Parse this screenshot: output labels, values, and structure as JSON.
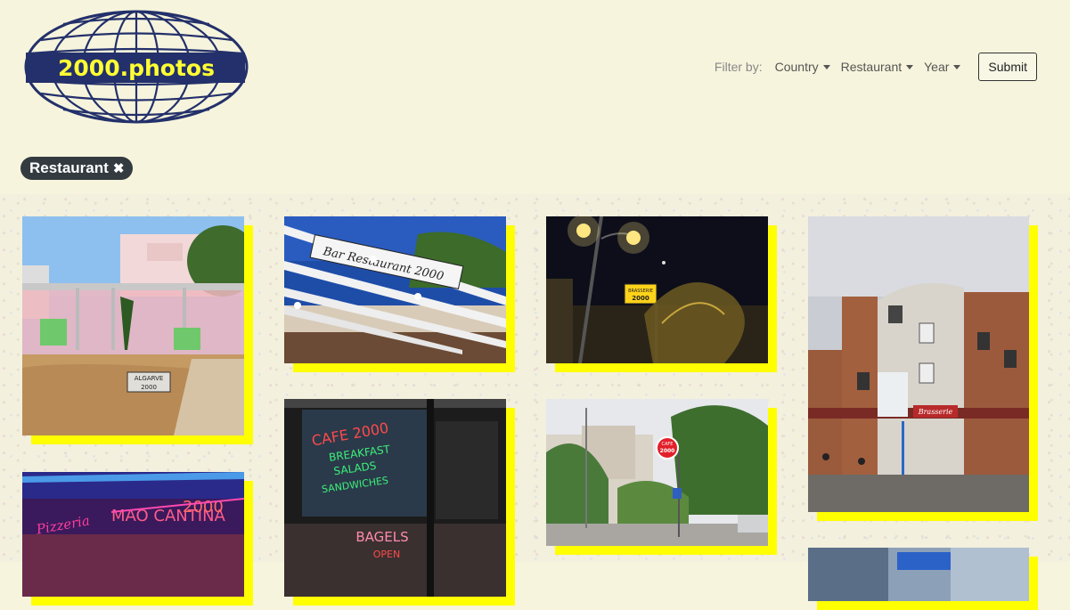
{
  "brand": {
    "logo_text": "2000.photos"
  },
  "filters": {
    "label": "Filter by:",
    "country": "Country",
    "restaurant": "Restaurant",
    "year": "Year",
    "submit": "Submit"
  },
  "active_tag": {
    "label": "Restaurant",
    "remove_glyph": "✖"
  },
  "photos": [
    {
      "sign_text": "ALGARVE 2000",
      "name": "photo-algarve-2000"
    },
    {
      "sign_text": "Bar Restaurant 2000",
      "name": "photo-bar-restaurant-2000"
    },
    {
      "sign_text": "BRASSERIE 2000",
      "name": "photo-brasserie-night"
    },
    {
      "sign_text": "Brasserie 2000",
      "name": "photo-brasserie-building"
    },
    {
      "sign_text": "Pizzeria MAO CANTINA 2000",
      "name": "photo-cantina-2000"
    },
    {
      "sign_text": "CAFE 2000 BREAKFAST SALADS SANDWICHES BAGELS OPEN",
      "name": "photo-cafe-2000"
    },
    {
      "sign_text": "CAFE 2000",
      "name": "photo-cafe-street"
    },
    {
      "sign_text": "",
      "name": "photo-bottom-right"
    }
  ]
}
